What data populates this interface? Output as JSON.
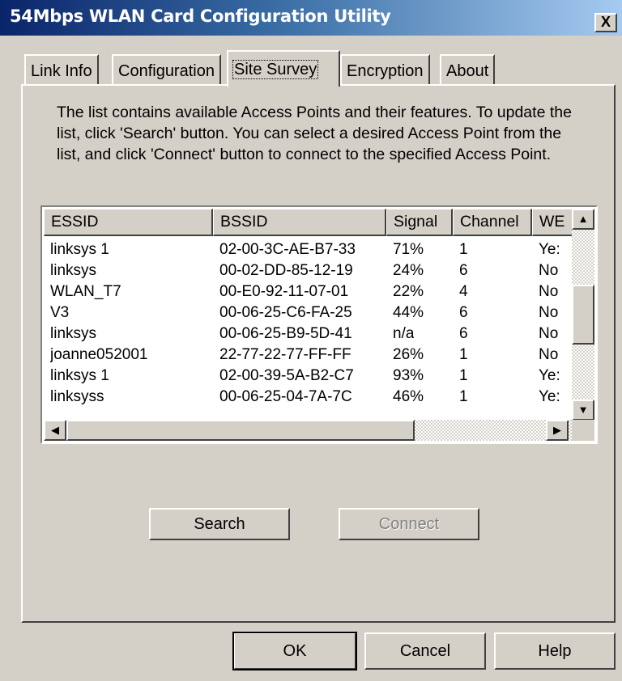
{
  "window": {
    "title": "54Mbps WLAN Card Configuration Utility",
    "close_symbol": "X"
  },
  "tabs": [
    {
      "label": "Link Info",
      "active": false
    },
    {
      "label": "Configuration",
      "active": false
    },
    {
      "label": "Site Survey",
      "active": true
    },
    {
      "label": "Encryption",
      "active": false
    },
    {
      "label": "About",
      "active": false
    }
  ],
  "description": "The list contains available Access Points and their features. To update the list, click 'Search' button. You can select a desired Access Point from the list, and click 'Connect' button to connect to the specified Access Point.",
  "ap_list": {
    "columns": [
      "ESSID",
      "BSSID",
      "Signal",
      "Channel",
      "WE"
    ],
    "rows": [
      [
        "linksys 1",
        "02-00-3C-AE-B7-33",
        "71%",
        "1",
        "Ye:"
      ],
      [
        "linksys",
        "00-02-DD-85-12-19",
        "24%",
        "6",
        "No"
      ],
      [
        "WLAN_T7",
        "00-E0-92-11-07-01",
        "22%",
        "4",
        "No"
      ],
      [
        "V3",
        "00-06-25-C6-FA-25",
        "44%",
        "6",
        "No"
      ],
      [
        "linksys",
        "00-06-25-B9-5D-41",
        "n/a",
        "6",
        "No"
      ],
      [
        "joanne052001",
        "22-77-22-77-FF-FF",
        "26%",
        "1",
        "No"
      ],
      [
        "linksys 1",
        "02-00-39-5A-B2-C7",
        "93%",
        "1",
        "Ye:"
      ],
      [
        "linksyss",
        "00-06-25-04-7A-7C",
        "46%",
        "1",
        "Ye:"
      ]
    ],
    "scroll_up_icon": "▲",
    "scroll_down_icon": "▼",
    "scroll_left_icon": "◀",
    "scroll_right_icon": "▶"
  },
  "buttons": {
    "search": "Search",
    "connect": "Connect",
    "ok": "OK",
    "cancel": "Cancel",
    "help": "Help"
  },
  "colors": {
    "titlebar_start": "#0a246a",
    "titlebar_end": "#a6caf0",
    "face": "#d4d0c8"
  }
}
